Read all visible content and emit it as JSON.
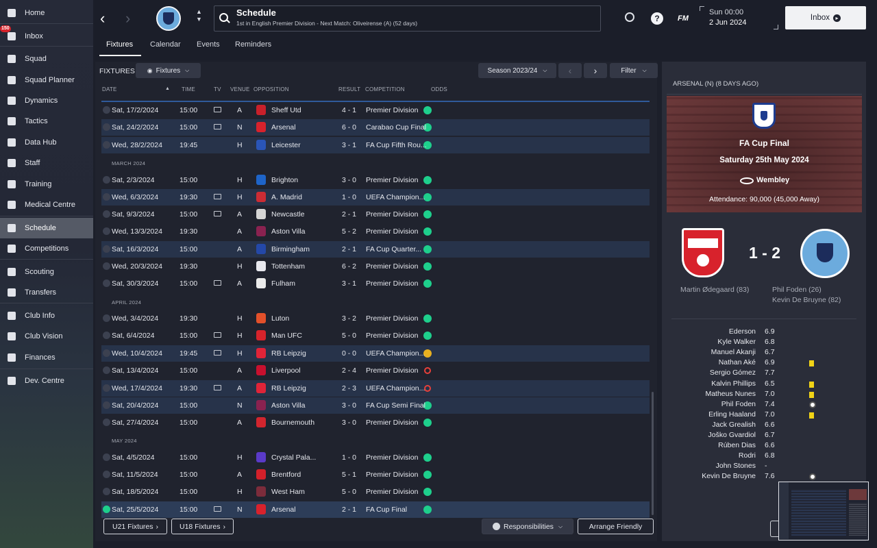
{
  "sidebar": {
    "items": [
      {
        "label": "Home",
        "icon": "home-icon"
      },
      {
        "label": "Inbox",
        "icon": "inbox-icon",
        "badge": "150"
      },
      {
        "label": "Squad",
        "icon": "shirt-icon"
      },
      {
        "label": "Squad Planner",
        "icon": "clipboard-icon"
      },
      {
        "label": "Dynamics",
        "icon": "handshake-icon"
      },
      {
        "label": "Tactics",
        "icon": "tactics-board-icon"
      },
      {
        "label": "Data Hub",
        "icon": "chart-circle-icon"
      },
      {
        "label": "Staff",
        "icon": "staff-icon"
      },
      {
        "label": "Training",
        "icon": "cone-icon"
      },
      {
        "label": "Medical Centre",
        "icon": "medical-icon"
      },
      {
        "label": "Schedule",
        "icon": "calendar-icon"
      },
      {
        "label": "Competitions",
        "icon": "trophy-icon"
      },
      {
        "label": "Scouting",
        "icon": "magnifier-icon"
      },
      {
        "label": "Transfers",
        "icon": "transfer-arrows-icon"
      },
      {
        "label": "Club Info",
        "icon": "shield-icon"
      },
      {
        "label": "Club Vision",
        "icon": "briefcase-icon"
      },
      {
        "label": "Finances",
        "icon": "money-icon"
      },
      {
        "label": "Dev. Centre",
        "icon": "growth-icon"
      }
    ]
  },
  "header": {
    "title": "Schedule",
    "subtitle": "1st in English Premier Division - Next Match: Oliveirense (A) (52 days)",
    "time": "Sun 00:00",
    "date": "2 Jun 2024",
    "inbox_label": "Inbox",
    "fm_label": "FM",
    "help_label": "?"
  },
  "tabs": [
    "Fixtures",
    "Calendar",
    "Events",
    "Reminders"
  ],
  "toolbar": {
    "fixtures_title": "FIXTURES",
    "view_label": "Fixtures",
    "season_label": "Season 2023/24",
    "filter_label": "Filter"
  },
  "columns": [
    "DATE",
    "TIME",
    "TV",
    "VENUE",
    "OPPOSITION",
    "RESULT",
    "COMPETITION",
    "ODDS"
  ],
  "months": [
    "MARCH 2024",
    "APRIL 2024",
    "MAY 2024"
  ],
  "fixtures": [
    {
      "date": "Sat, 17/2/2024",
      "time": "15:00",
      "tv": true,
      "venue": "A",
      "opp": "Sheff Utd",
      "res": "w",
      "score": "4 - 1",
      "comp": "Premier Division",
      "crest": "#c8202a"
    },
    {
      "date": "Sat, 24/2/2024",
      "time": "15:00",
      "tv": true,
      "venue": "N",
      "opp": "Arsenal",
      "res": "w",
      "score": "6 - 0",
      "comp": "Carabao Cup Final",
      "crest": "#d8222c"
    },
    {
      "date": "Wed, 28/2/2024",
      "time": "19:45",
      "tv": false,
      "venue": "H",
      "opp": "Leicester",
      "res": "w",
      "score": "3 - 1",
      "comp": "FA Cup Fifth Rou...",
      "crest": "#2a55b8"
    },
    {
      "date": "Sat, 2/3/2024",
      "time": "15:00",
      "tv": false,
      "venue": "H",
      "opp": "Brighton",
      "res": "w",
      "score": "3 - 0",
      "comp": "Premier Division",
      "crest": "#1e64c8"
    },
    {
      "date": "Wed, 6/3/2024",
      "time": "19:30",
      "tv": true,
      "venue": "H",
      "opp": "A. Madrid",
      "res": "w",
      "score": "1 - 0",
      "comp": "UEFA Champion...",
      "crest": "#cc2c34"
    },
    {
      "date": "Sat, 9/3/2024",
      "time": "15:00",
      "tv": true,
      "venue": "A",
      "opp": "Newcastle",
      "res": "w",
      "score": "2 - 1",
      "comp": "Premier Division",
      "crest": "#d5d5d5"
    },
    {
      "date": "Wed, 13/3/2024",
      "time": "19:30",
      "tv": false,
      "venue": "A",
      "opp": "Aston Villa",
      "res": "w",
      "score": "5 - 2",
      "comp": "Premier Division",
      "crest": "#8a2250"
    },
    {
      "date": "Sat, 16/3/2024",
      "time": "15:00",
      "tv": false,
      "venue": "A",
      "opp": "Birmingham",
      "res": "w",
      "score": "2 - 1",
      "comp": "FA Cup Quarter...",
      "crest": "#2448a8"
    },
    {
      "date": "Wed, 20/3/2024",
      "time": "19:30",
      "tv": false,
      "venue": "H",
      "opp": "Tottenham",
      "res": "w",
      "score": "6 - 2",
      "comp": "Premier Division",
      "crest": "#e8e8ee"
    },
    {
      "date": "Sat, 30/3/2024",
      "time": "15:00",
      "tv": true,
      "venue": "A",
      "opp": "Fulham",
      "res": "w",
      "score": "3 - 1",
      "comp": "Premier Division",
      "crest": "#ebebeb"
    },
    {
      "date": "Wed, 3/4/2024",
      "time": "19:30",
      "tv": false,
      "venue": "H",
      "opp": "Luton",
      "res": "w",
      "score": "3 - 2",
      "comp": "Premier Division",
      "crest": "#e2502a"
    },
    {
      "date": "Sat, 6/4/2024",
      "time": "15:00",
      "tv": true,
      "venue": "H",
      "opp": "Man UFC",
      "res": "w",
      "score": "5 - 0",
      "comp": "Premier Division",
      "crest": "#d6232b"
    },
    {
      "date": "Wed, 10/4/2024",
      "time": "19:45",
      "tv": true,
      "venue": "H",
      "opp": "RB Leipzig",
      "res": "d",
      "score": "0 - 0",
      "comp": "UEFA Champion...",
      "crest": "#e02438"
    },
    {
      "date": "Sat, 13/4/2024",
      "time": "15:00",
      "tv": false,
      "venue": "A",
      "opp": "Liverpool",
      "res": "l",
      "score": "2 - 4",
      "comp": "Premier Division",
      "crest": "#c8102e"
    },
    {
      "date": "Wed, 17/4/2024",
      "time": "19:30",
      "tv": true,
      "venue": "A",
      "opp": "RB Leipzig",
      "res": "l",
      "score": "2 - 3",
      "comp": "UEFA Champion...",
      "crest": "#e02438"
    },
    {
      "date": "Sat, 20/4/2024",
      "time": "15:00",
      "tv": false,
      "venue": "N",
      "opp": "Aston Villa",
      "res": "w",
      "score": "3 - 0",
      "comp": "FA Cup Semi Final",
      "crest": "#8a2250"
    },
    {
      "date": "Sat, 27/4/2024",
      "time": "15:00",
      "tv": false,
      "venue": "A",
      "opp": "Bournemouth",
      "res": "w",
      "score": "3 - 0",
      "comp": "Premier Division",
      "crest": "#d2252e"
    },
    {
      "date": "Sat, 4/5/2024",
      "time": "15:00",
      "tv": false,
      "venue": "H",
      "opp": "Crystal Pala...",
      "res": "w",
      "score": "1 - 0",
      "comp": "Premier Division",
      "crest": "#5a3ac8"
    },
    {
      "date": "Sat, 11/5/2024",
      "time": "15:00",
      "tv": false,
      "venue": "A",
      "opp": "Brentford",
      "res": "w",
      "score": "5 - 1",
      "comp": "Premier Division",
      "crest": "#d3202a"
    },
    {
      "date": "Sat, 18/5/2024",
      "time": "15:00",
      "tv": false,
      "venue": "H",
      "opp": "West Ham",
      "res": "w",
      "score": "5 - 0",
      "comp": "Premier Division",
      "crest": "#7c2c3b"
    },
    {
      "date": "Sat, 25/5/2024",
      "time": "15:00",
      "tv": true,
      "venue": "N",
      "opp": "Arsenal",
      "res": "w",
      "score": "2 - 1",
      "comp": "FA Cup Final",
      "crest": "#d8222c"
    }
  ],
  "bottom": {
    "u21": "U21 Fixtures",
    "u18": "U18 Fixtures",
    "responsibilities": "Responsibilities",
    "arrange": "Arrange Friendly"
  },
  "match": {
    "header": "ARSENAL (N) (8 DAYS AGO)",
    "competition": "FA Cup Final",
    "date": "Saturday 25th May 2024",
    "venue": "Wembley",
    "attendance": "Attendance: 90,000 (45,000 Away)",
    "score": "1 - 2",
    "home_scorers": [
      "Martin Ødegaard (83)"
    ],
    "away_scorers": [
      "Phil Foden (26)",
      "Kevin De Bruyne (82)"
    ]
  },
  "players": [
    {
      "name": "Ederson",
      "rating": "6.9",
      "mark": ""
    },
    {
      "name": "Kyle Walker",
      "rating": "6.8",
      "mark": ""
    },
    {
      "name": "Manuel Akanji",
      "rating": "6.7",
      "mark": ""
    },
    {
      "name": "Nathan Aké",
      "rating": "6.9",
      "mark": "card"
    },
    {
      "name": "Sergio Gómez",
      "rating": "7.7",
      "mark": ""
    },
    {
      "name": "Kalvin Phillips",
      "rating": "6.5",
      "mark": "card"
    },
    {
      "name": "Matheus Nunes",
      "rating": "7.0",
      "mark": "card"
    },
    {
      "name": "Phil Foden",
      "rating": "7.4",
      "mark": "goal"
    },
    {
      "name": "Erling Haaland",
      "rating": "7.0",
      "mark": "card"
    },
    {
      "name": "Jack Grealish",
      "rating": "6.6",
      "mark": ""
    },
    {
      "name": "Joško Gvardiol",
      "rating": "6.7",
      "mark": ""
    },
    {
      "name": "Rúben Dias",
      "rating": "6.6",
      "mark": ""
    },
    {
      "name": "Rodri",
      "rating": "6.8",
      "mark": ""
    },
    {
      "name": "John Stones",
      "rating": "-",
      "mark": ""
    },
    {
      "name": "Kevin De Bruyne",
      "rating": "7.6",
      "mark": "goal"
    }
  ],
  "colors": {
    "win": "#1ecf8c",
    "draw": "#e8b020",
    "loss": "#e8403a",
    "highlight": "#27334a",
    "selected": "#2d3d58"
  }
}
